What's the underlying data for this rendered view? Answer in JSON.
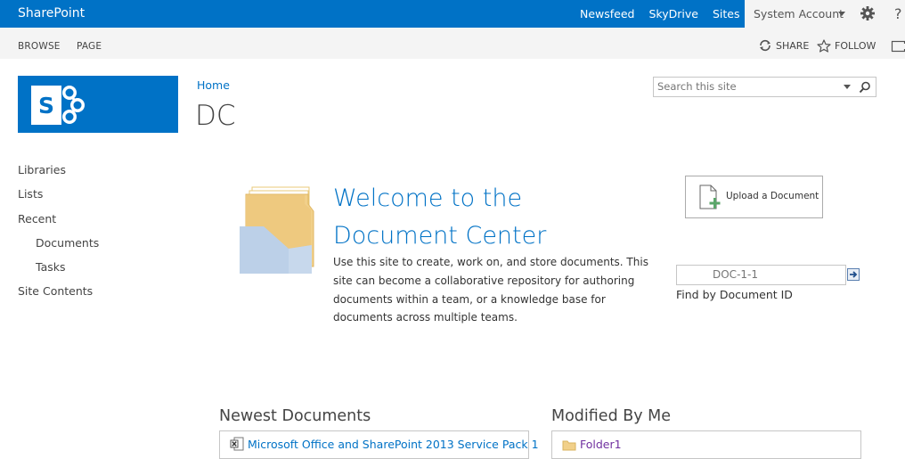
{
  "suite": {
    "brand": "SharePoint",
    "links": [
      "Newsfeed",
      "SkyDrive",
      "Sites"
    ],
    "account": "System Account",
    "help": "?"
  },
  "ribbon": {
    "tabs": [
      "BROWSE",
      "PAGE"
    ],
    "share": "SHARE",
    "follow": "FOLLOW"
  },
  "breadcrumb": {
    "home": "Home"
  },
  "page": {
    "title": "DC"
  },
  "search": {
    "placeholder": "Search this site"
  },
  "nav": {
    "items": [
      "Libraries",
      "Lists",
      "Recent",
      "Documents",
      "Tasks",
      "Site Contents"
    ]
  },
  "welcome": {
    "title": "Welcome to the Document Center",
    "description": "Use this site to create, work on, and store documents. This site can become a collaborative repository for authoring documents within a team, or a knowledge base for documents across multiple teams."
  },
  "upload": {
    "label": "Upload a Document"
  },
  "find": {
    "placeholder": "DOC-1-1",
    "label": "Find by Document ID"
  },
  "newest": {
    "title": "Newest Documents",
    "items": [
      "Microsoft Office and SharePoint 2013 Service Pack 1"
    ]
  },
  "modified": {
    "title": "Modified By Me",
    "items": [
      "Folder1"
    ]
  },
  "colors": {
    "suite_blue": "#0072c6",
    "ribbon_gray": "#f4f4f4",
    "link_blue": "#0072c6",
    "folder_link": "#7030a0"
  }
}
